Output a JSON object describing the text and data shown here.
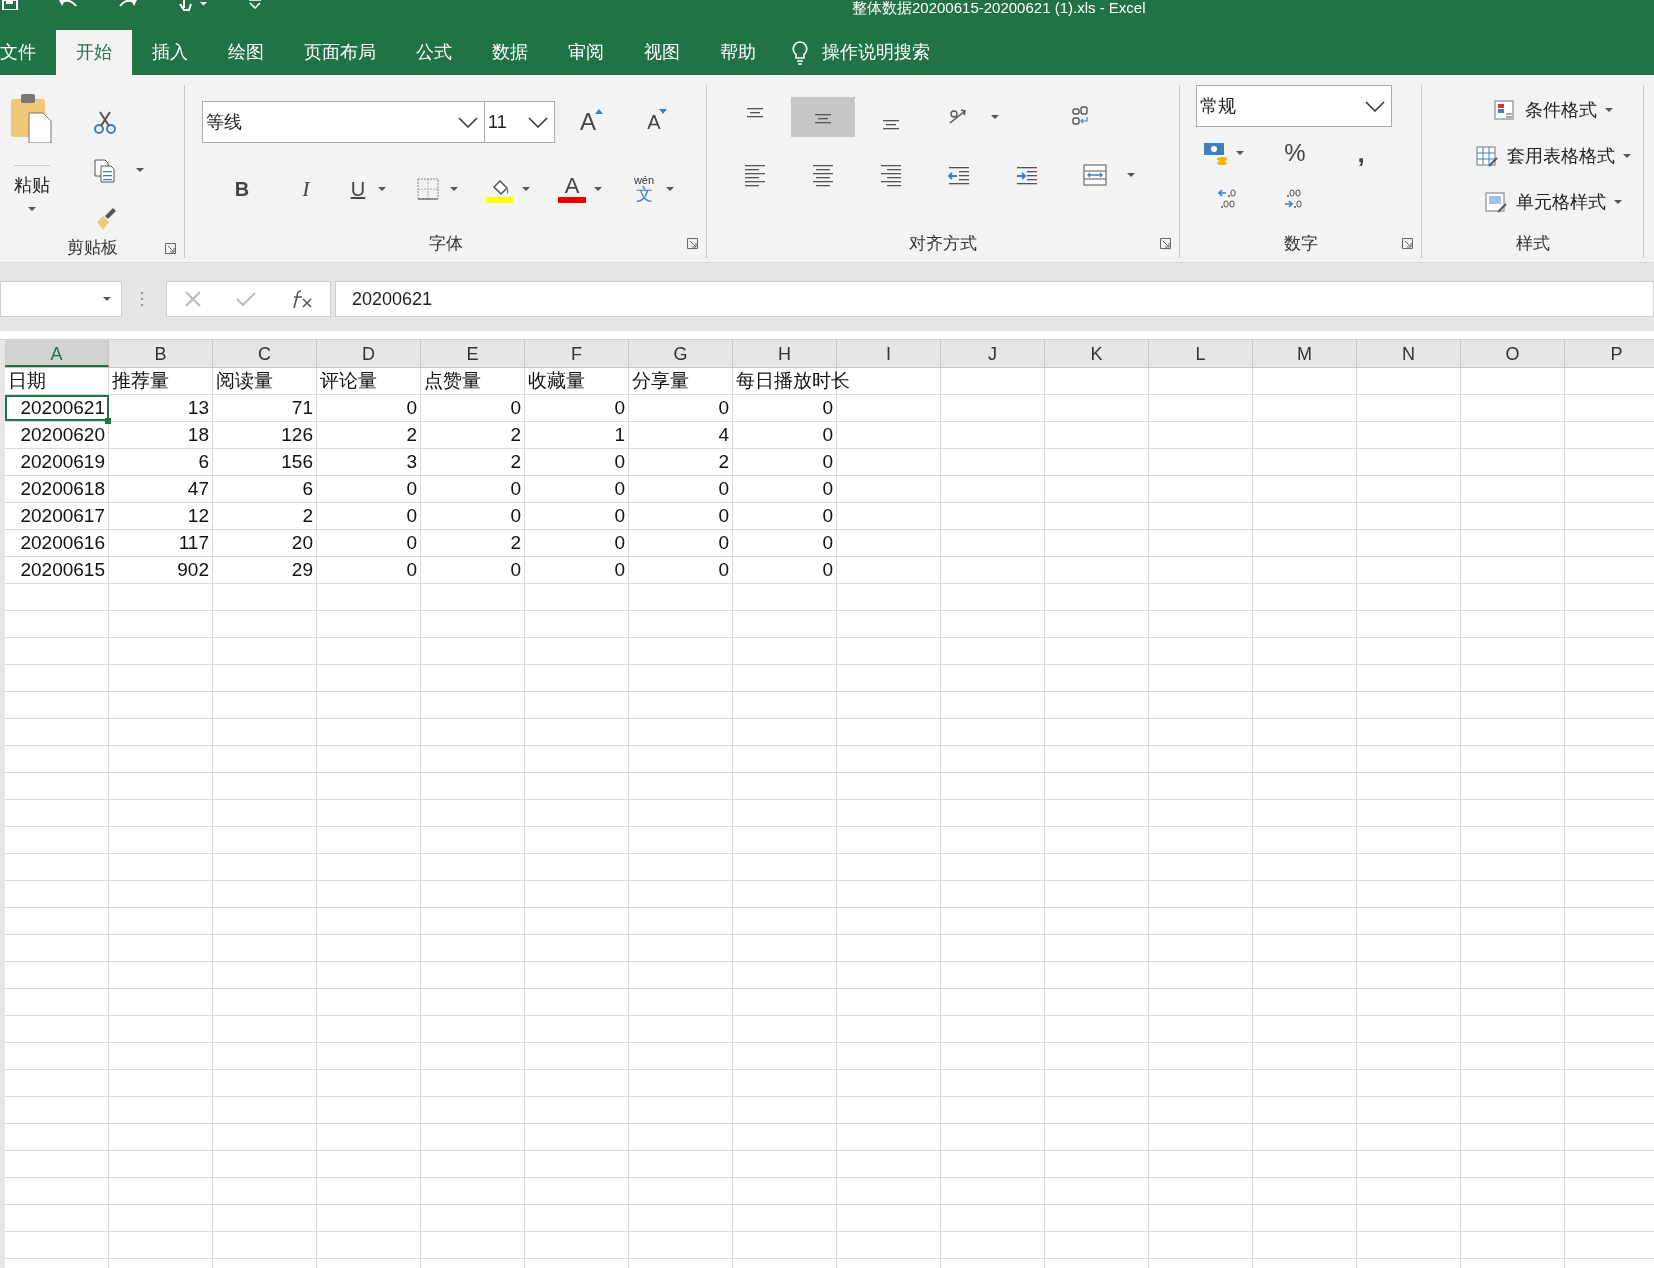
{
  "quick_access": [
    {
      "kind": "save"
    },
    {
      "kind": "undo"
    },
    {
      "kind": "redo"
    },
    {
      "kind": "touch"
    },
    {
      "kind": "customize"
    }
  ],
  "window": {
    "title": "整体数据20200615-20200621 (1).xls  -  Excel"
  },
  "tabs": [
    {
      "label": "文件",
      "selected": false
    },
    {
      "label": "开始",
      "selected": true
    },
    {
      "label": "插入",
      "selected": false
    },
    {
      "label": "绘图",
      "selected": false
    },
    {
      "label": "页面布局",
      "selected": false
    },
    {
      "label": "公式",
      "selected": false
    },
    {
      "label": "数据",
      "selected": false
    },
    {
      "label": "审阅",
      "selected": false
    },
    {
      "label": "视图",
      "selected": false
    },
    {
      "label": "帮助",
      "selected": false
    }
  ],
  "tell_me": {
    "placeholder": "操作说明搜索"
  },
  "ribbon": {
    "clipboard": {
      "label": "剪贴板",
      "paste": "粘贴"
    },
    "font": {
      "label": "字体",
      "font_name": "等线",
      "font_size": "11",
      "grow": "A",
      "shrink": "A",
      "bold": "B",
      "italic": "I",
      "underline": "U",
      "font_color": "A",
      "phonetic": "文",
      "phonetic_ruby": "wén"
    },
    "alignment": {
      "label": "对齐方式",
      "buttons": [
        {
          "kind": "top",
          "selected": false
        },
        {
          "kind": "middle",
          "selected": true
        },
        {
          "kind": "bottom",
          "selected": false
        },
        {
          "kind": "orientation",
          "selected": false
        },
        {
          "kind": "wrap",
          "selected": false
        },
        {
          "kind": "left",
          "selected": false
        },
        {
          "kind": "center",
          "selected": false
        },
        {
          "kind": "right",
          "selected": false
        },
        {
          "kind": "outdent",
          "selected": false
        },
        {
          "kind": "indent",
          "selected": false
        },
        {
          "kind": "merge",
          "selected": false
        }
      ]
    },
    "number": {
      "label": "数字",
      "format": "常规",
      "percent": "%",
      "comma": ","
    },
    "styles": {
      "label": "样式",
      "items": [
        "条件格式",
        "套用表格格式",
        "单元格样式"
      ]
    }
  },
  "formula_bar": {
    "value": "20200621"
  },
  "sheet": {
    "columns": [
      {
        "label": "A",
        "selected": true
      },
      {
        "label": "B",
        "selected": false
      },
      {
        "label": "C",
        "selected": false
      },
      {
        "label": "D",
        "selected": false
      },
      {
        "label": "E",
        "selected": false
      },
      {
        "label": "F",
        "selected": false
      },
      {
        "label": "G",
        "selected": false
      },
      {
        "label": "H",
        "selected": false
      },
      {
        "label": "I",
        "selected": false
      },
      {
        "label": "J",
        "selected": false
      },
      {
        "label": "K",
        "selected": false
      },
      {
        "label": "L",
        "selected": false
      },
      {
        "label": "M",
        "selected": false
      },
      {
        "label": "N",
        "selected": false
      },
      {
        "label": "O",
        "selected": false
      },
      {
        "label": "P",
        "selected": false
      }
    ],
    "rows": [
      {
        "kind": "header",
        "selected": false,
        "cells": [
          "日期",
          "推荐量",
          "阅读量",
          "评论量",
          "点赞量",
          "收藏量",
          "分享量",
          "每日播放时长"
        ]
      },
      {
        "kind": "data",
        "selected": true,
        "cells": [
          "20200621",
          "13",
          "71",
          "0",
          "0",
          "0",
          "0",
          "0"
        ]
      },
      {
        "kind": "data",
        "selected": false,
        "cells": [
          "20200620",
          "18",
          "126",
          "2",
          "2",
          "1",
          "4",
          "0"
        ]
      },
      {
        "kind": "data",
        "selected": false,
        "cells": [
          "20200619",
          "6",
          "156",
          "3",
          "2",
          "0",
          "2",
          "0"
        ]
      },
      {
        "kind": "data",
        "selected": false,
        "cells": [
          "20200618",
          "47",
          "6",
          "0",
          "0",
          "0",
          "0",
          "0"
        ]
      },
      {
        "kind": "data",
        "selected": false,
        "cells": [
          "20200617",
          "12",
          "2",
          "0",
          "0",
          "0",
          "0",
          "0"
        ]
      },
      {
        "kind": "data",
        "selected": false,
        "cells": [
          "20200616",
          "117",
          "20",
          "0",
          "2",
          "0",
          "0",
          "0"
        ]
      },
      {
        "kind": "data",
        "selected": false,
        "cells": [
          "20200615",
          "902",
          "29",
          "0",
          "0",
          "0",
          "0",
          "0"
        ]
      }
    ]
  }
}
